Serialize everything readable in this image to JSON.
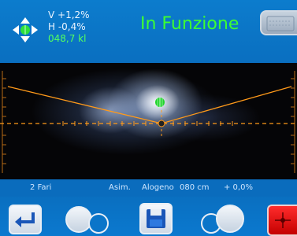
{
  "header": {
    "vertical_offset": "V +1,2%",
    "horizontal_offset": "H -0,4%",
    "illuminance": "048,7 kl",
    "status": "In Funzione"
  },
  "info_bar": {
    "headlights": "2 Fari",
    "beam_type": "Asim.",
    "lamp_type": "Alogeno",
    "distance": "080 cm",
    "tilt": "+ 0,0%"
  },
  "icons": {
    "navigation": "four-way-arrows-icon",
    "back": "return-arrow-icon",
    "left_lamp": "left-lamp-select-icon",
    "save": "floppy-disk-icon",
    "right_lamp": "right-lamp-select-icon",
    "stop": "red-stop-icon"
  },
  "colors": {
    "panel_blue": "#0a6fc0",
    "status_green": "#3cff32",
    "cutoff_orange": "#ff9a1a",
    "stop_red": "#e00000"
  }
}
